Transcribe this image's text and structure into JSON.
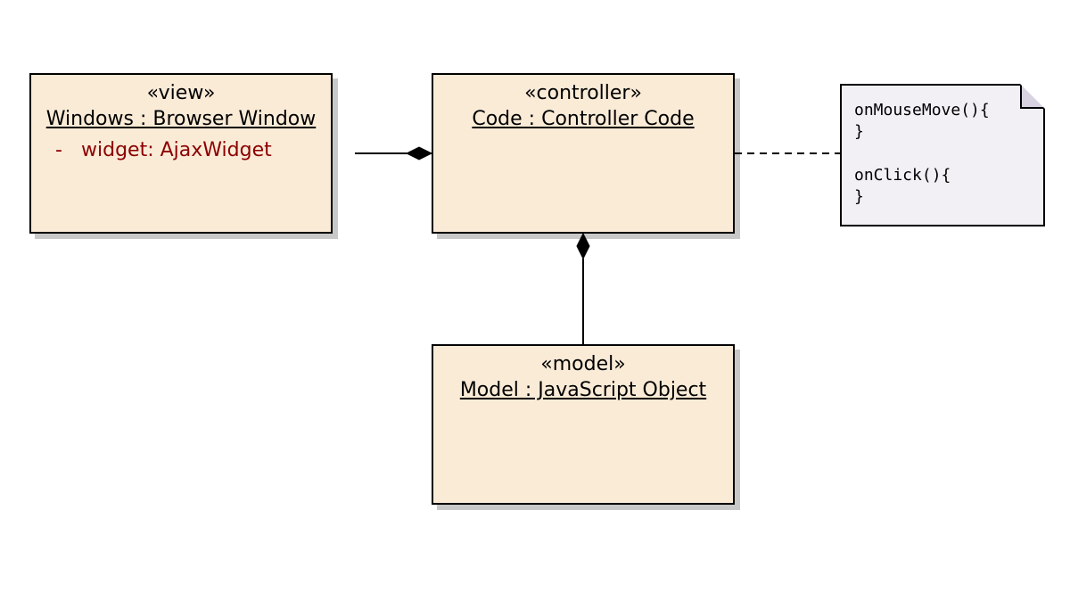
{
  "boxes": {
    "view": {
      "stereotype": "«view»",
      "name": "Windows : Browser Window",
      "attr_visibility": "-",
      "attr_text": "widget: AjaxWidget"
    },
    "controller": {
      "stereotype": "«controller»",
      "name": "Code : Controller Code"
    },
    "model": {
      "stereotype": "«model»",
      "name": "Model : JavaScript Object"
    }
  },
  "note": {
    "line1": "onMouseMove(){",
    "line2": "}",
    "line3": "",
    "line4": "onClick(){",
    "line5": "}"
  }
}
